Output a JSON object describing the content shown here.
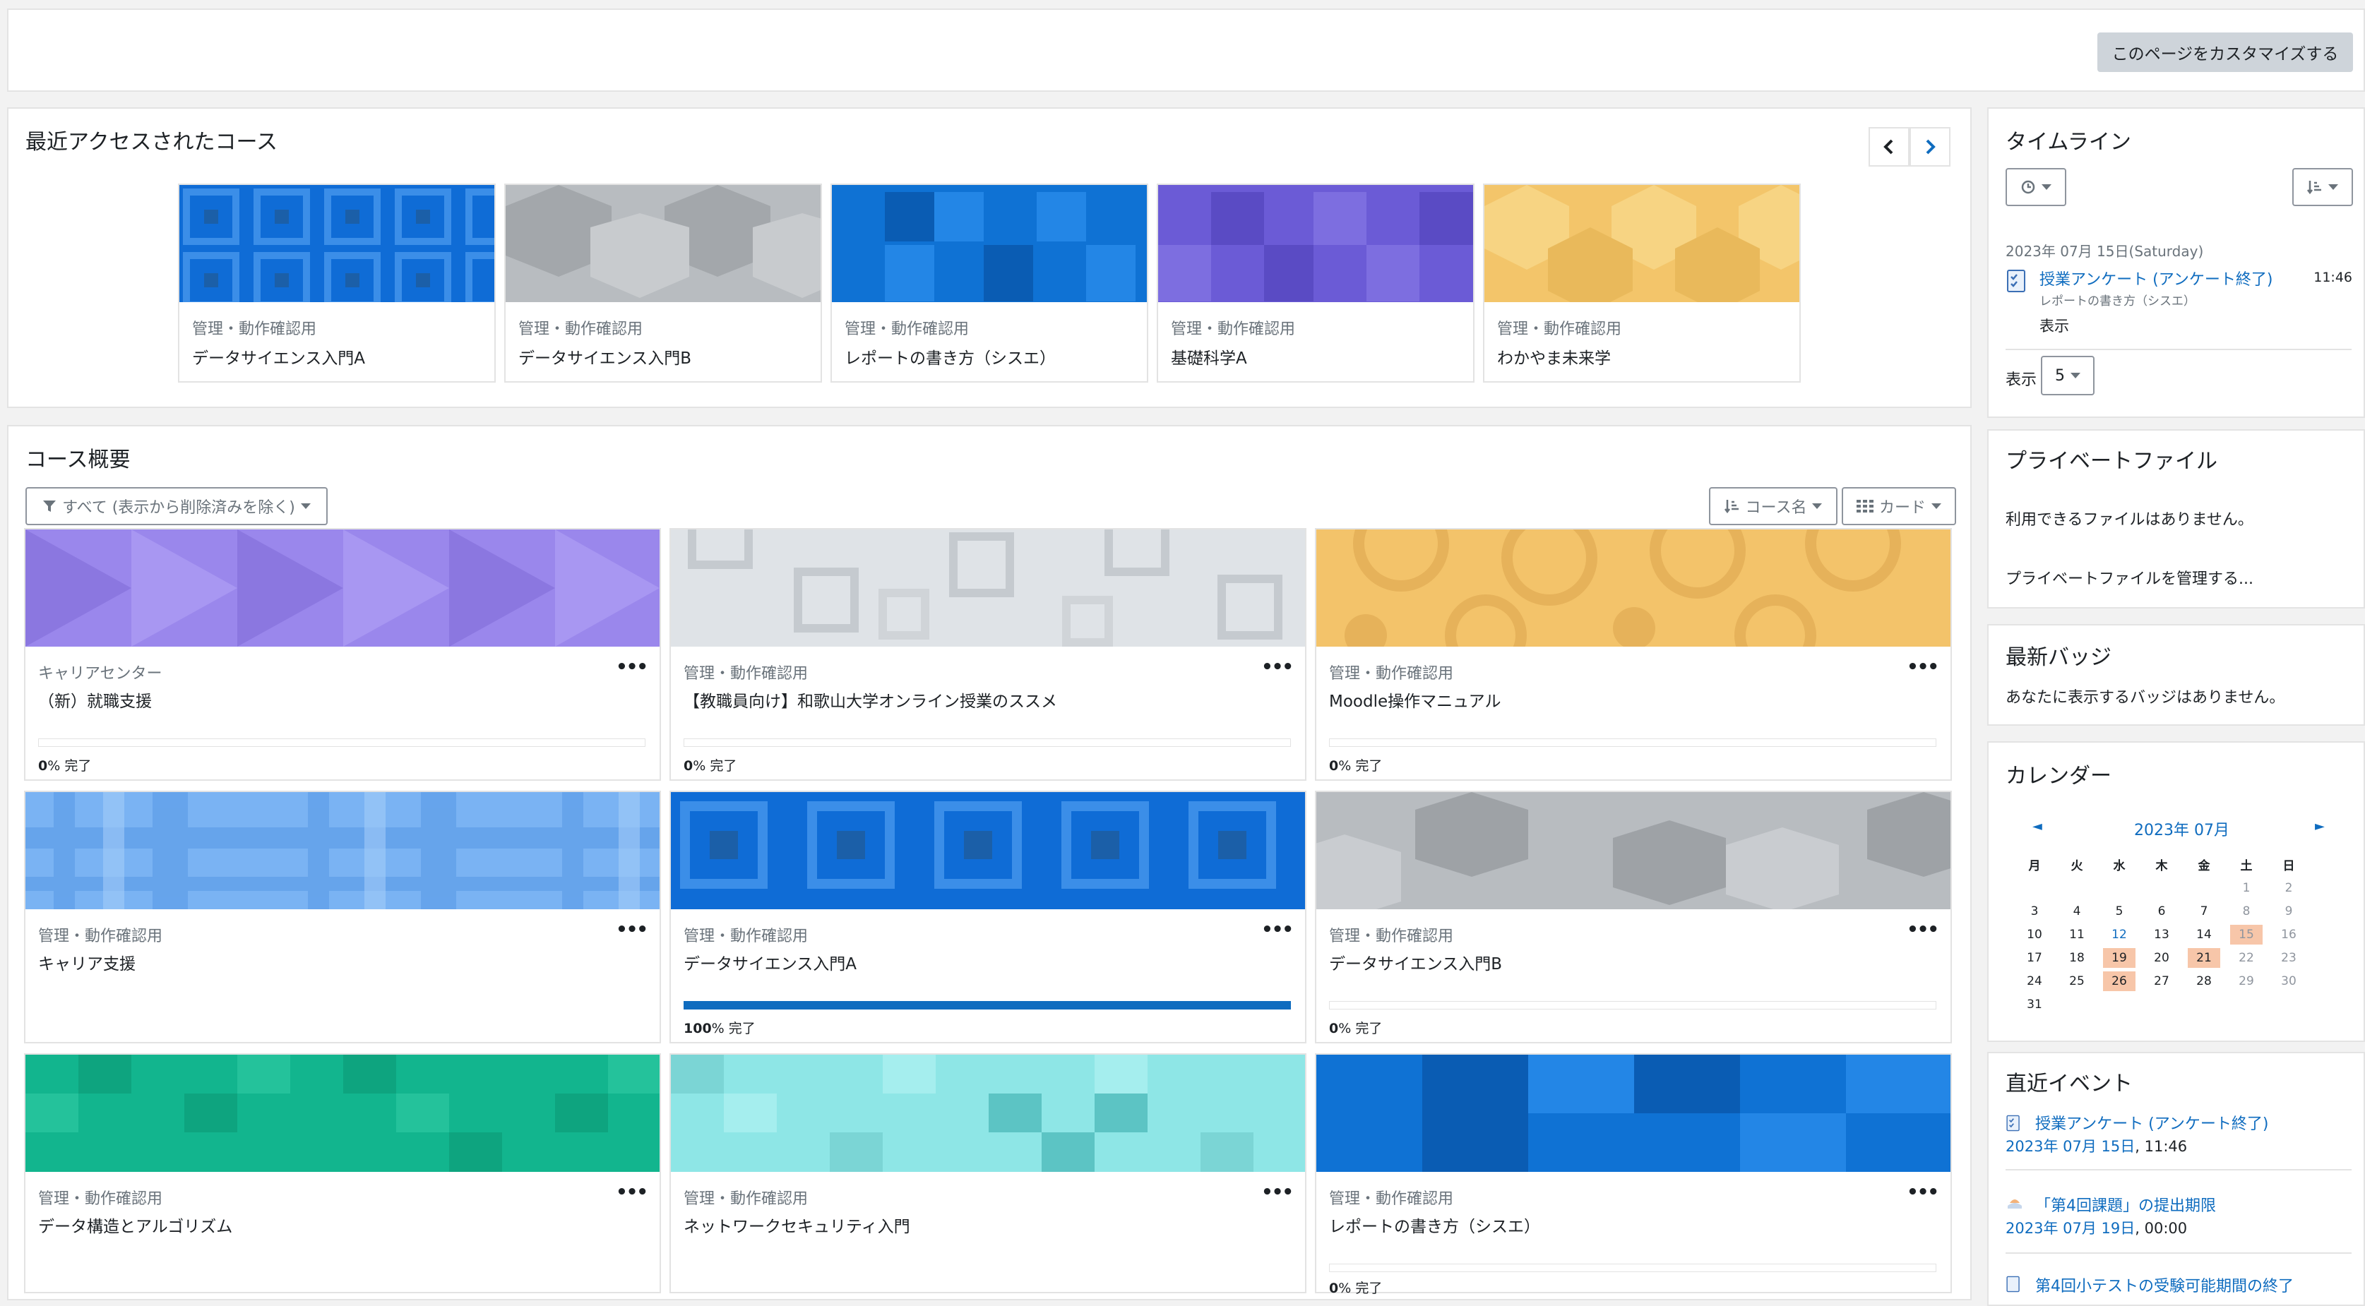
{
  "header": {
    "customize_button": "このページをカスタマイズする"
  },
  "recent": {
    "title": "最近アクセスされたコース",
    "courses": [
      {
        "category": "管理・動作確認用",
        "name": "データサイエンス入門A"
      },
      {
        "category": "管理・動作確認用",
        "name": "データサイエンス入門B"
      },
      {
        "category": "管理・動作確認用",
        "name": "レポートの書き方（シスエ）"
      },
      {
        "category": "管理・動作確認用",
        "name": "基礎科学A"
      },
      {
        "category": "管理・動作確認用",
        "name": "わかやま未来学"
      }
    ]
  },
  "overview": {
    "title": "コース概要",
    "filter_label": "すべて (表示から削除済みを除く)",
    "sort_label": "コース名",
    "view_label": "カード",
    "courses": [
      {
        "category": "キャリアセンター",
        "name": "（新）就職支援",
        "progress": "0",
        "complete": "% 完了",
        "progress_fraction": 0
      },
      {
        "category": "管理・動作確認用",
        "name": "【教職員向け】和歌山大学オンライン授業のススメ",
        "progress": "0",
        "complete": "% 完了",
        "progress_fraction": 0
      },
      {
        "category": "管理・動作確認用",
        "name": "Moodle操作マニュアル",
        "progress": "0",
        "complete": "% 完了",
        "progress_fraction": 0
      },
      {
        "category": "管理・動作確認用",
        "name": "キャリア支援",
        "progress": "",
        "complete": "",
        "progress_fraction": null
      },
      {
        "category": "管理・動作確認用",
        "name": "データサイエンス入門A",
        "progress": "100",
        "complete": "% 完了",
        "progress_fraction": 1
      },
      {
        "category": "管理・動作確認用",
        "name": "データサイエンス入門B",
        "progress": "0",
        "complete": "% 完了",
        "progress_fraction": 0
      },
      {
        "category": "管理・動作確認用",
        "name": "データ構造とアルゴリズム",
        "progress": "",
        "complete": "",
        "progress_fraction": null
      },
      {
        "category": "管理・動作確認用",
        "name": "ネットワークセキュリティ入門",
        "progress": "",
        "complete": "",
        "progress_fraction": null
      },
      {
        "category": "管理・動作確認用",
        "name": "レポートの書き方（シスエ）",
        "progress": "0",
        "complete": "% 完了",
        "progress_fraction": 0
      }
    ]
  },
  "timeline": {
    "title": "タイムライン",
    "date_label": "2023年 07月 15日(Saturday)",
    "event_title": "授業アンケート (アンケート終了)",
    "event_course": "レポートの書き方（シスエ）",
    "event_time": "11:46",
    "view_action": "表示",
    "show_label": "表示",
    "show_count": "5"
  },
  "private_files": {
    "title": "プライベートファイル",
    "empty_text": "利用できるファイルはありません。",
    "manage_link": "プライベートファイルを管理する..."
  },
  "badges": {
    "title": "最新バッジ",
    "empty_text": "あなたに表示するバッジはありません。"
  },
  "calendar": {
    "title": "カレンダー",
    "month_label": "2023年 07月",
    "prev": "◄",
    "next": "►",
    "weekdays": [
      "月",
      "火",
      "水",
      "木",
      "金",
      "土",
      "日"
    ]
  },
  "upcoming": {
    "title": "直近イベント",
    "events": [
      {
        "title": "授業アンケート (アンケート終了)",
        "date": "2023年 07月 15日",
        "time": ", 11:46"
      },
      {
        "title": "「第4回課題」の提出期限",
        "date": "2023年 07月 19日",
        "time": ", 00:00"
      },
      {
        "title": "第4回小テストの受験可能期間の終了",
        "date": "",
        "time": ""
      }
    ]
  },
  "colors": {
    "accent": "#0f6cbf",
    "highlight": "#f7c6a9"
  }
}
